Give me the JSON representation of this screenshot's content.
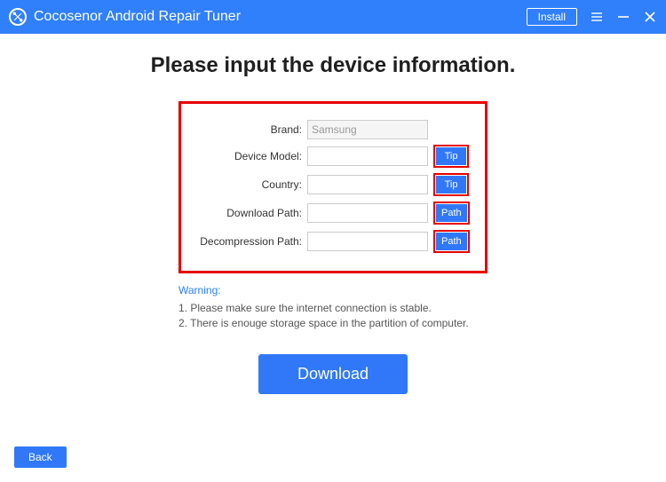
{
  "titlebar": {
    "app_name": "Cocosenor Android Repair Tuner",
    "install_label": "Install"
  },
  "page": {
    "title": "Please input the device information."
  },
  "form": {
    "brand_label": "Brand:",
    "brand_value": "Samsung",
    "model_label": "Device Model:",
    "model_value": "",
    "model_btn": "Tip",
    "country_label": "Country:",
    "country_value": "",
    "country_btn": "Tip",
    "download_label": "Download Path:",
    "download_value": "",
    "download_btn": "Path",
    "decompress_label": "Decompression Path:",
    "decompress_value": "",
    "decompress_btn": "Path"
  },
  "warning": {
    "title": "Warning:",
    "line1": "1. Please make sure the internet connection is stable.",
    "line2": "2. There is enouge storage space in the partition of computer."
  },
  "actions": {
    "download": "Download",
    "back": "Back"
  }
}
